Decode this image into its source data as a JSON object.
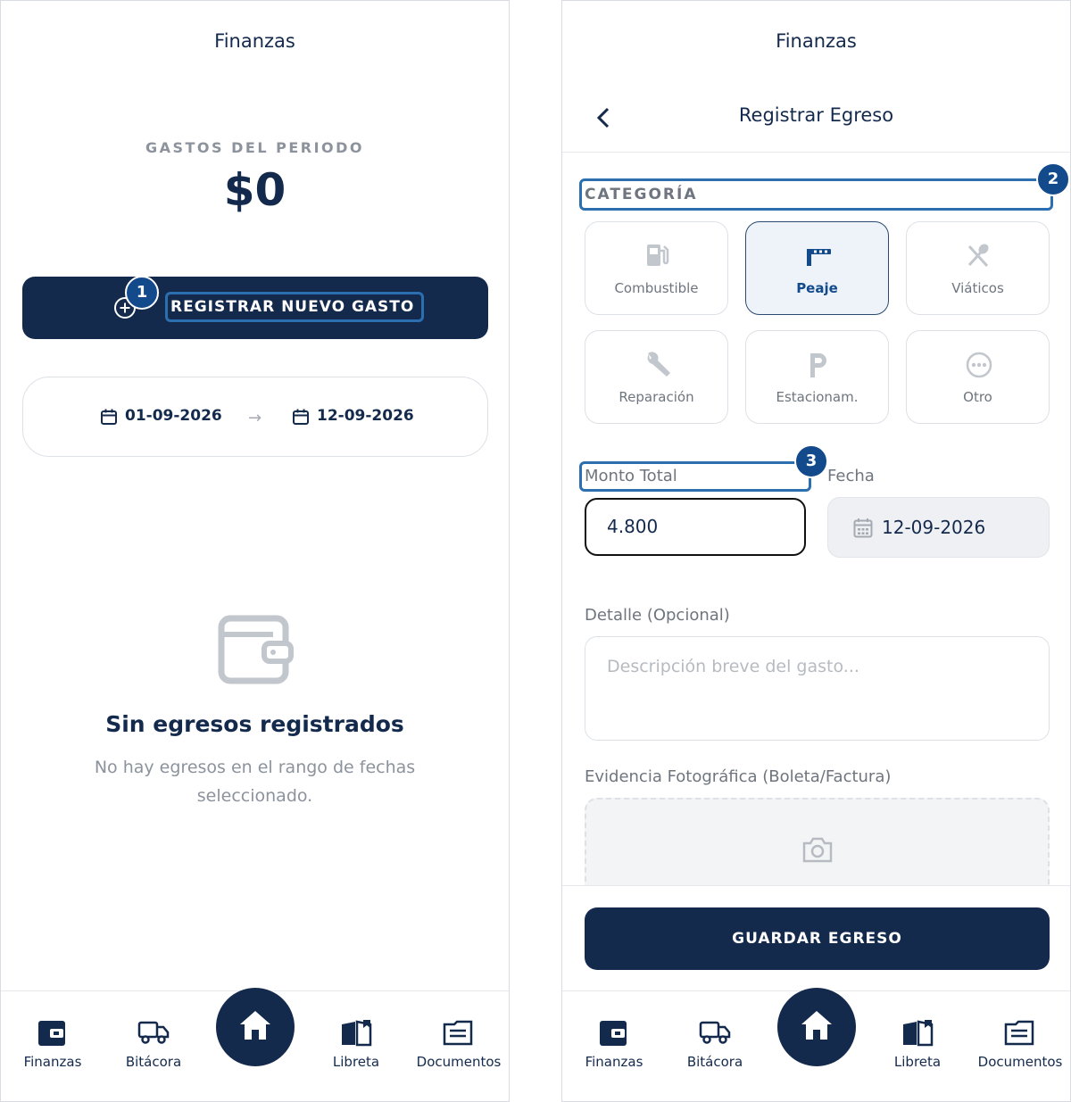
{
  "left_screen": {
    "title": "Finanzas",
    "period_label": "GASTOS DEL PERIODO",
    "period_amount": "$0",
    "new_expense_button": "REGISTRAR NUEVO GASTO",
    "badge_1": "1",
    "date_from": "01-09-2026",
    "date_arrow": "→",
    "date_to": "12-09-2026",
    "empty_title": "Sin egresos registrados",
    "empty_description": "No hay egresos en el rango de fechas seleccionado."
  },
  "right_screen": {
    "title": "Finanzas",
    "subtitle": "Registrar Egreso",
    "category_label": "CATEGORÍA",
    "badge_2": "2",
    "categories": [
      {
        "label": "Combustible",
        "icon": "fuel-pump-icon"
      },
      {
        "label": "Peaje",
        "icon": "toll-barrier-icon",
        "selected": true
      },
      {
        "label": "Viáticos",
        "icon": "fork-knife-icon"
      },
      {
        "label": "Reparación",
        "icon": "wrench-icon"
      },
      {
        "label": "Estacionam.",
        "icon": "parking-icon"
      },
      {
        "label": "Otro",
        "icon": "ellipsis-circle-icon"
      }
    ],
    "amount_label": "Monto Total",
    "badge_3": "3",
    "amount_value": "4.800",
    "date_label": "Fecha",
    "date_value": "12-09-2026",
    "detail_label": "Detalle (Opcional)",
    "detail_placeholder": "Descripción breve del gasto...",
    "evidence_label": "Evidencia Fotográfica (Boleta/Factura)",
    "save_button": "GUARDAR EGRESO"
  },
  "nav": {
    "items": [
      {
        "label": "Finanzas",
        "icon": "wallet-icon"
      },
      {
        "label": "Bitácora",
        "icon": "truck-icon"
      },
      {
        "label": "Libreta",
        "icon": "book-icon"
      },
      {
        "label": "Documentos",
        "icon": "document-icon"
      }
    ],
    "home_icon": "home-icon"
  },
  "colors": {
    "navy": "#142a4d",
    "highlight_blue": "#2c6fb0",
    "badge_blue": "#124a8c",
    "muted_text": "#8c939c"
  }
}
